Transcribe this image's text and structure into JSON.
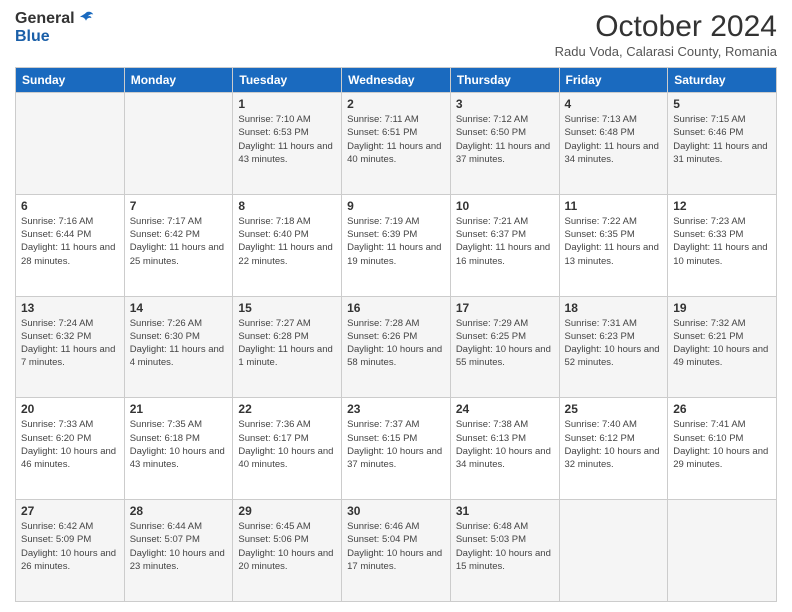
{
  "header": {
    "logo_general": "General",
    "logo_blue": "Blue",
    "month_title": "October 2024",
    "location": "Radu Voda, Calarasi County, Romania"
  },
  "days_of_week": [
    "Sunday",
    "Monday",
    "Tuesday",
    "Wednesday",
    "Thursday",
    "Friday",
    "Saturday"
  ],
  "weeks": [
    [
      {
        "day": "",
        "info": ""
      },
      {
        "day": "",
        "info": ""
      },
      {
        "day": "1",
        "info": "Sunrise: 7:10 AM\nSunset: 6:53 PM\nDaylight: 11 hours and 43 minutes."
      },
      {
        "day": "2",
        "info": "Sunrise: 7:11 AM\nSunset: 6:51 PM\nDaylight: 11 hours and 40 minutes."
      },
      {
        "day": "3",
        "info": "Sunrise: 7:12 AM\nSunset: 6:50 PM\nDaylight: 11 hours and 37 minutes."
      },
      {
        "day": "4",
        "info": "Sunrise: 7:13 AM\nSunset: 6:48 PM\nDaylight: 11 hours and 34 minutes."
      },
      {
        "day": "5",
        "info": "Sunrise: 7:15 AM\nSunset: 6:46 PM\nDaylight: 11 hours and 31 minutes."
      }
    ],
    [
      {
        "day": "6",
        "info": "Sunrise: 7:16 AM\nSunset: 6:44 PM\nDaylight: 11 hours and 28 minutes."
      },
      {
        "day": "7",
        "info": "Sunrise: 7:17 AM\nSunset: 6:42 PM\nDaylight: 11 hours and 25 minutes."
      },
      {
        "day": "8",
        "info": "Sunrise: 7:18 AM\nSunset: 6:40 PM\nDaylight: 11 hours and 22 minutes."
      },
      {
        "day": "9",
        "info": "Sunrise: 7:19 AM\nSunset: 6:39 PM\nDaylight: 11 hours and 19 minutes."
      },
      {
        "day": "10",
        "info": "Sunrise: 7:21 AM\nSunset: 6:37 PM\nDaylight: 11 hours and 16 minutes."
      },
      {
        "day": "11",
        "info": "Sunrise: 7:22 AM\nSunset: 6:35 PM\nDaylight: 11 hours and 13 minutes."
      },
      {
        "day": "12",
        "info": "Sunrise: 7:23 AM\nSunset: 6:33 PM\nDaylight: 11 hours and 10 minutes."
      }
    ],
    [
      {
        "day": "13",
        "info": "Sunrise: 7:24 AM\nSunset: 6:32 PM\nDaylight: 11 hours and 7 minutes."
      },
      {
        "day": "14",
        "info": "Sunrise: 7:26 AM\nSunset: 6:30 PM\nDaylight: 11 hours and 4 minutes."
      },
      {
        "day": "15",
        "info": "Sunrise: 7:27 AM\nSunset: 6:28 PM\nDaylight: 11 hours and 1 minute."
      },
      {
        "day": "16",
        "info": "Sunrise: 7:28 AM\nSunset: 6:26 PM\nDaylight: 10 hours and 58 minutes."
      },
      {
        "day": "17",
        "info": "Sunrise: 7:29 AM\nSunset: 6:25 PM\nDaylight: 10 hours and 55 minutes."
      },
      {
        "day": "18",
        "info": "Sunrise: 7:31 AM\nSunset: 6:23 PM\nDaylight: 10 hours and 52 minutes."
      },
      {
        "day": "19",
        "info": "Sunrise: 7:32 AM\nSunset: 6:21 PM\nDaylight: 10 hours and 49 minutes."
      }
    ],
    [
      {
        "day": "20",
        "info": "Sunrise: 7:33 AM\nSunset: 6:20 PM\nDaylight: 10 hours and 46 minutes."
      },
      {
        "day": "21",
        "info": "Sunrise: 7:35 AM\nSunset: 6:18 PM\nDaylight: 10 hours and 43 minutes."
      },
      {
        "day": "22",
        "info": "Sunrise: 7:36 AM\nSunset: 6:17 PM\nDaylight: 10 hours and 40 minutes."
      },
      {
        "day": "23",
        "info": "Sunrise: 7:37 AM\nSunset: 6:15 PM\nDaylight: 10 hours and 37 minutes."
      },
      {
        "day": "24",
        "info": "Sunrise: 7:38 AM\nSunset: 6:13 PM\nDaylight: 10 hours and 34 minutes."
      },
      {
        "day": "25",
        "info": "Sunrise: 7:40 AM\nSunset: 6:12 PM\nDaylight: 10 hours and 32 minutes."
      },
      {
        "day": "26",
        "info": "Sunrise: 7:41 AM\nSunset: 6:10 PM\nDaylight: 10 hours and 29 minutes."
      }
    ],
    [
      {
        "day": "27",
        "info": "Sunrise: 6:42 AM\nSunset: 5:09 PM\nDaylight: 10 hours and 26 minutes."
      },
      {
        "day": "28",
        "info": "Sunrise: 6:44 AM\nSunset: 5:07 PM\nDaylight: 10 hours and 23 minutes."
      },
      {
        "day": "29",
        "info": "Sunrise: 6:45 AM\nSunset: 5:06 PM\nDaylight: 10 hours and 20 minutes."
      },
      {
        "day": "30",
        "info": "Sunrise: 6:46 AM\nSunset: 5:04 PM\nDaylight: 10 hours and 17 minutes."
      },
      {
        "day": "31",
        "info": "Sunrise: 6:48 AM\nSunset: 5:03 PM\nDaylight: 10 hours and 15 minutes."
      },
      {
        "day": "",
        "info": ""
      },
      {
        "day": "",
        "info": ""
      }
    ]
  ]
}
